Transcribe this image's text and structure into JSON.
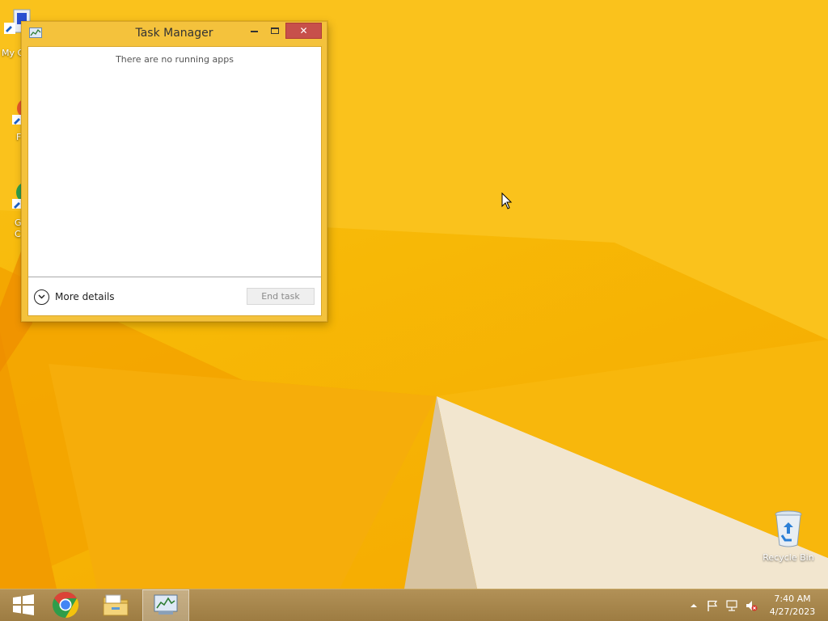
{
  "desktop": {
    "icons": [
      {
        "label": "My C",
        "icon": "computer-icon"
      },
      {
        "label": "F",
        "icon": "firefox-shortcut-icon"
      },
      {
        "label": "G C",
        "icon": "chrome-shortcut-icon"
      },
      {
        "label": "Recycle Bin",
        "icon": "recycle-bin-icon"
      }
    ]
  },
  "window": {
    "title": "Task Manager",
    "icon": "task-manager-icon",
    "controls": {
      "minimize": "–",
      "maximize": "□",
      "close": "✕"
    },
    "empty_message": "There are no running apps",
    "more_details_label": "More details",
    "end_task_label": "End task"
  },
  "taskbar": {
    "items": [
      {
        "name": "start-button",
        "icon": "windows-logo-icon"
      },
      {
        "name": "chrome",
        "icon": "chrome-icon"
      },
      {
        "name": "file-explorer",
        "icon": "folder-icon"
      },
      {
        "name": "task-manager",
        "icon": "task-manager-icon",
        "active": true
      }
    ],
    "tray": [
      "show-hidden-icons",
      "action-center-flag-icon",
      "network-icon",
      "volume-muted-icon"
    ],
    "clock": {
      "time": "7:40 AM",
      "date": "4/27/2023"
    }
  },
  "colors": {
    "wallpaper": "#f7b806",
    "taskbar": "#a8874e",
    "window_frame": "#f4c23c",
    "close_button": "#c7504b"
  }
}
